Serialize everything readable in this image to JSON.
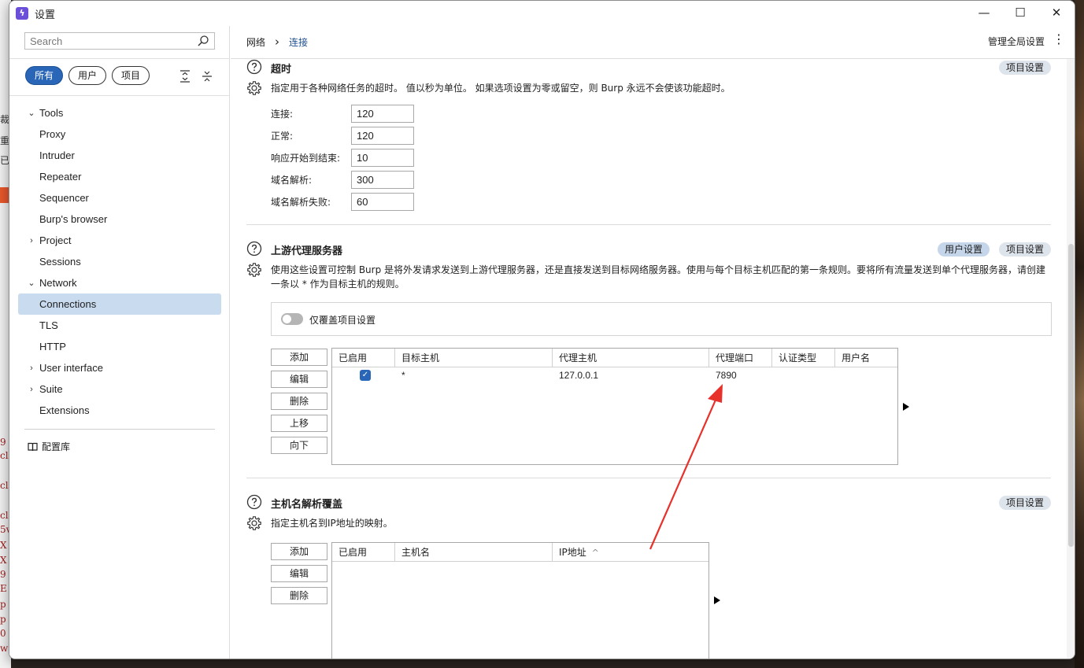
{
  "window": {
    "title": "设置",
    "controls": {
      "minimize": "—",
      "maximize": "☐",
      "close": "✕"
    }
  },
  "sidebar": {
    "search_placeholder": "Search",
    "filters": [
      "所有",
      "用户",
      "项目"
    ],
    "tree": [
      {
        "label": "Tools",
        "level": 0,
        "chevron": "⌄"
      },
      {
        "label": "Proxy",
        "level": 1
      },
      {
        "label": "Intruder",
        "level": 1
      },
      {
        "label": "Repeater",
        "level": 1
      },
      {
        "label": "Sequencer",
        "level": 1
      },
      {
        "label": "Burp's browser",
        "level": 1
      },
      {
        "label": "Project",
        "level": 0,
        "chevron": "›"
      },
      {
        "label": "Sessions",
        "level": 0
      },
      {
        "label": "Network",
        "level": 0,
        "chevron": "⌄"
      },
      {
        "label": "Connections",
        "level": 1,
        "selected": true
      },
      {
        "label": "TLS",
        "level": 1
      },
      {
        "label": "HTTP",
        "level": 1
      },
      {
        "label": "User interface",
        "level": 0,
        "chevron": "›"
      },
      {
        "label": "Suite",
        "level": 0,
        "chevron": "›"
      },
      {
        "label": "Extensions",
        "level": 0
      }
    ],
    "library": "配置库"
  },
  "header": {
    "breadcrumb": [
      "网络",
      "连接"
    ],
    "breadcrumb_sep": "›",
    "manage": "管理全局设置"
  },
  "timeout": {
    "title": "超时",
    "badge": "项目设置",
    "description": "指定用于各种网络任务的超时。 值以秒为单位。 如果选项设置为零或留空，则 Burp 永远不会使该功能超时。",
    "fields": [
      {
        "label": "连接:",
        "value": "120"
      },
      {
        "label": "正常:",
        "value": "120"
      },
      {
        "label": "响应开始到结束:",
        "value": "10"
      },
      {
        "label": "域名解析:",
        "value": "300"
      },
      {
        "label": "域名解析失败:",
        "value": "60"
      }
    ]
  },
  "upstream": {
    "title": "上游代理服务器",
    "badge_user": "用户设置",
    "badge_project": "项目设置",
    "description_1": "使用这些设置可控制 Burp 是将外发请求发送到上游代理服务器，还是直接发送到目标网络服务器。使用与每个目标主机匹配的第一条规则。要将所有流量发送到单个代理服务器，请创建",
    "description_2": "一条以 * 作为目标主机的规则。",
    "override_label": "仅覆盖项目设置",
    "override_on": false,
    "buttons": [
      "添加",
      "编辑",
      "删除",
      "上移",
      "向下"
    ],
    "columns": [
      "已启用",
      "目标主机",
      "代理主机",
      "代理端口",
      "认证类型",
      "用户名"
    ],
    "rows": [
      {
        "enabled": true,
        "target": "*",
        "proxy_host": "127.0.0.1",
        "proxy_port": "7890",
        "auth": "",
        "user": ""
      }
    ]
  },
  "hostname": {
    "title": "主机名解析覆盖",
    "badge": "项目设置",
    "description": "指定主机名到IP地址的映射。",
    "buttons": [
      "添加",
      "编辑",
      "删除"
    ],
    "columns": [
      "已启用",
      "主机名",
      "IP地址"
    ],
    "sort_indicator": "^"
  },
  "colors": {
    "accent": "#2a66b8",
    "selected": "#c9dbef",
    "annotation": "#e8312a"
  }
}
